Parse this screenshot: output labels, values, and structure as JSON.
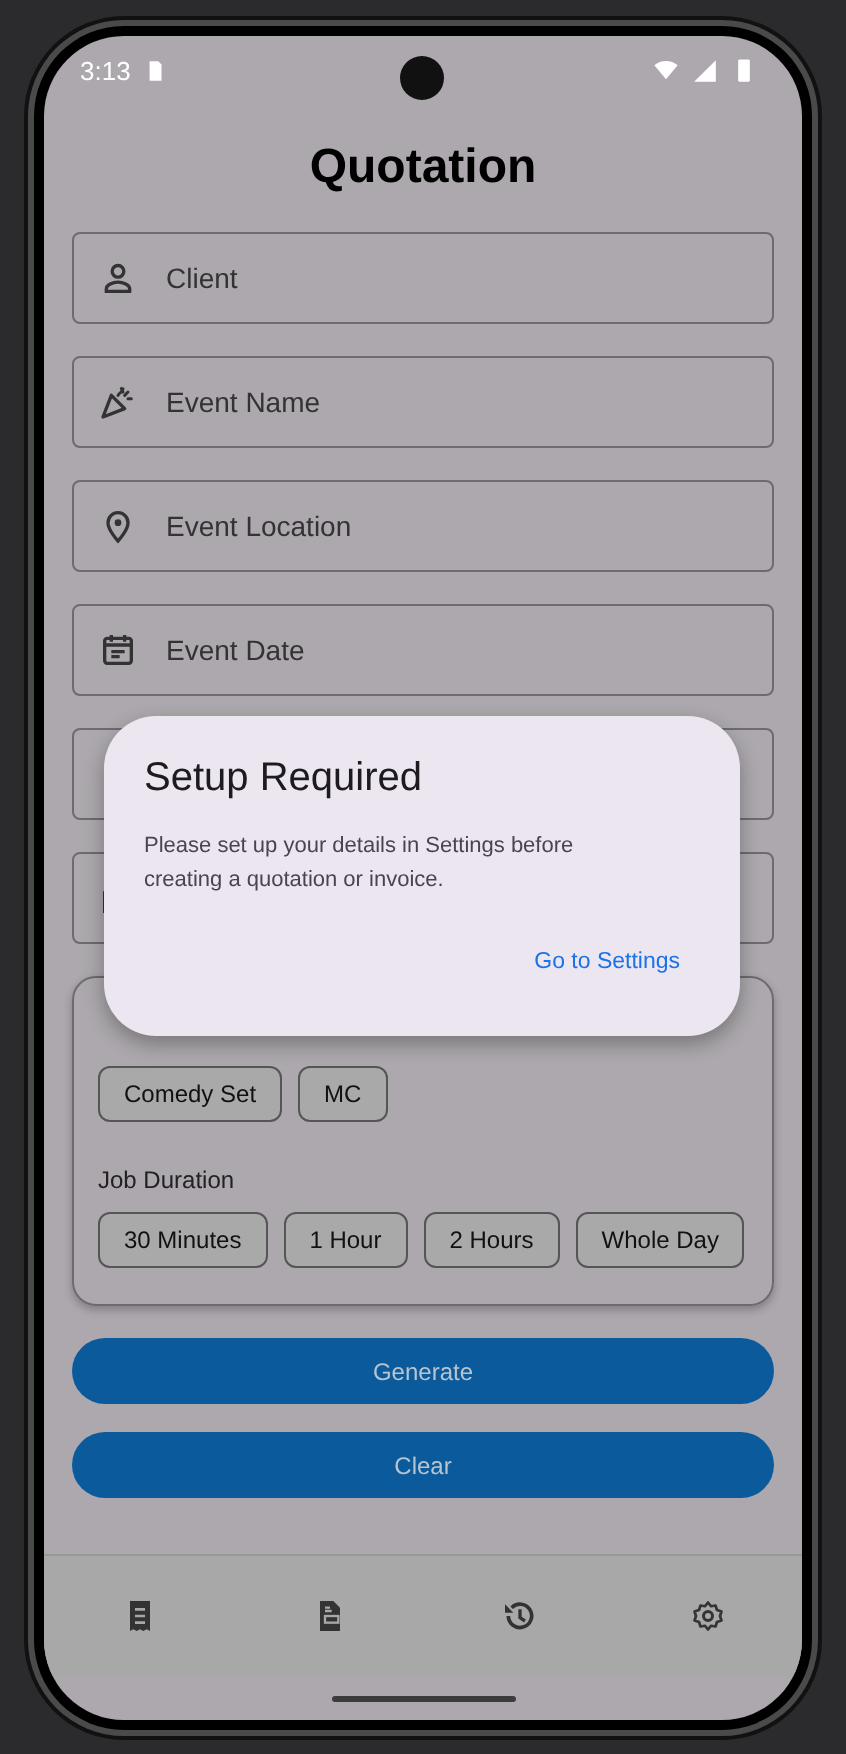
{
  "status_bar": {
    "time": "3:13"
  },
  "title": "Quotation",
  "fields": [
    {
      "placeholder": "Client"
    },
    {
      "placeholder": "Event Name"
    },
    {
      "placeholder": "Event Location"
    },
    {
      "placeholder": "Event Date"
    }
  ],
  "job_type": {
    "options": [
      "Comedy Set",
      "MC"
    ]
  },
  "job_duration": {
    "label": "Job Duration",
    "options": [
      "30 Minutes",
      "1 Hour",
      "2 Hours",
      "Whole Day"
    ]
  },
  "buttons": [
    "Generate",
    "Clear"
  ],
  "dialog": {
    "title": "Setup Required",
    "message": "Please set up your details in Settings before creating a quotation or invoice.",
    "action": "Go to Settings"
  }
}
